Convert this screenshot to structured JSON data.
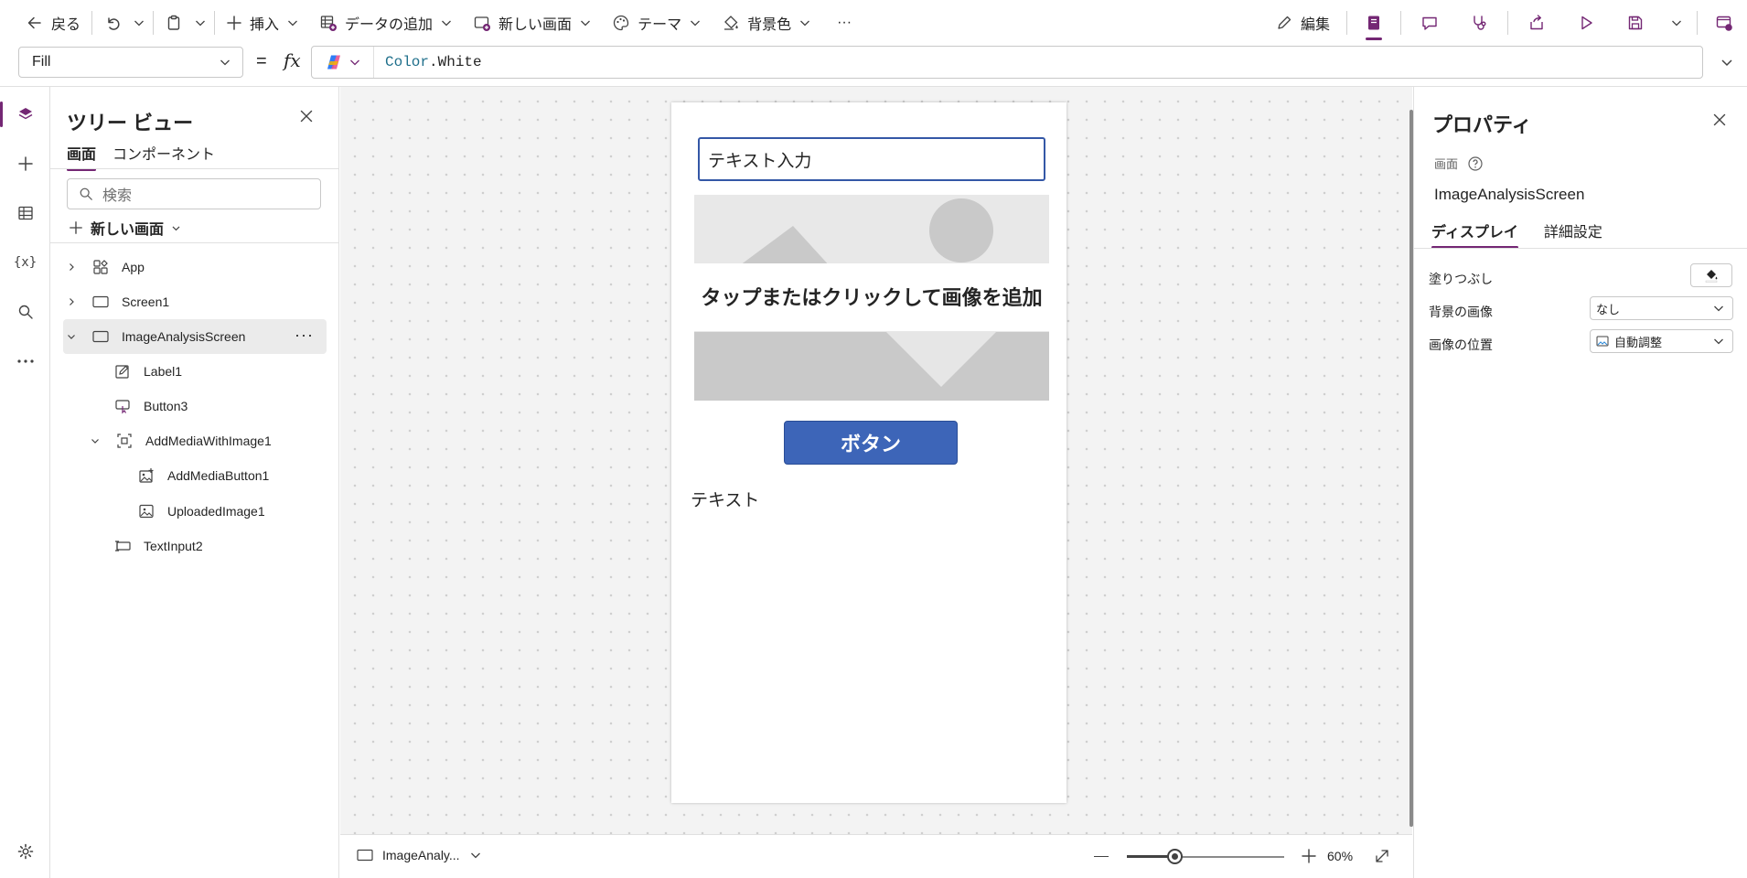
{
  "toolbar": {
    "back": "戻る",
    "insert": "挿入",
    "add_data": "データの追加",
    "new_screen": "新しい画面",
    "theme": "テーマ",
    "background_color": "背景色",
    "more": "···",
    "edit": "編集",
    "accent": "#742774"
  },
  "formula_bar": {
    "property": "Fill",
    "equals": "=",
    "fx": "fx",
    "formula_keyword": "Color",
    "formula_rest": ".White"
  },
  "left_rail": {
    "vars_label": "{x}"
  },
  "tree": {
    "title": "ツリー ビュー",
    "tabs": [
      "画面",
      "コンポーネント"
    ],
    "search_placeholder": "検索",
    "new_screen": "新しい画面",
    "nodes": [
      {
        "label": "App"
      },
      {
        "label": "Screen1"
      },
      {
        "label": "ImageAnalysisScreen"
      },
      {
        "label": "Label1"
      },
      {
        "label": "Button3"
      },
      {
        "label": "AddMediaWithImage1"
      },
      {
        "label": "AddMediaButton1"
      },
      {
        "label": "UploadedImage1"
      },
      {
        "label": "TextInput2"
      }
    ]
  },
  "canvas": {
    "text_input": "テキスト入力",
    "add_image": "タップまたはクリックして画像を追加",
    "button": "ボタン",
    "label": "テキスト",
    "button_color": "#3d65b8"
  },
  "footer": {
    "screen_name": "ImageAnaly...",
    "zoom": "60%",
    "zoom_level": 0.6
  },
  "properties": {
    "title": "プロパティ",
    "type": "画面",
    "name": "ImageAnalysisScreen",
    "tabs": [
      "ディスプレイ",
      "詳細設定"
    ],
    "rows": [
      {
        "label": "塗りつぶし"
      },
      {
        "label": "背景の画像",
        "value": "なし"
      },
      {
        "label": "画像の位置",
        "value": "自動調整"
      }
    ]
  }
}
